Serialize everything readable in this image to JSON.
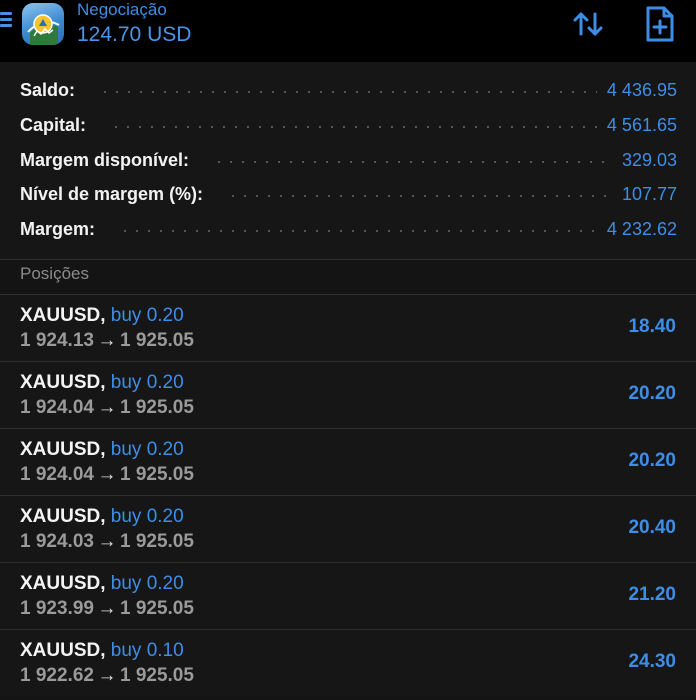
{
  "header": {
    "title": "Negociação",
    "subtitle": "124.70 USD",
    "icons": {
      "menu": "hamburger-menu-icon",
      "logo": "metatrader-logo",
      "sort": "sort-arrows-icon",
      "new_order": "new-order-document-plus-icon"
    }
  },
  "account": {
    "rows": [
      {
        "label": "Saldo:",
        "value": "4 436.95"
      },
      {
        "label": "Capital:",
        "value": "4 561.65"
      },
      {
        "label": "Margem disponível:",
        "value": "329.03"
      },
      {
        "label": "Nível de margem (%):",
        "value": "107.77"
      },
      {
        "label": "Margem:",
        "value": "4 232.62"
      }
    ]
  },
  "positions": {
    "header": "Posições",
    "items": [
      {
        "symbol": "XAUUSD",
        "comma": ",",
        "type": "buy 0.20",
        "open_price": "1 924.13",
        "arrow": "→",
        "current_price": "1 925.05",
        "profit": "18.40"
      },
      {
        "symbol": "XAUUSD",
        "comma": ",",
        "type": "buy 0.20",
        "open_price": "1 924.04",
        "arrow": "→",
        "current_price": "1 925.05",
        "profit": "20.20"
      },
      {
        "symbol": "XAUUSD",
        "comma": ",",
        "type": "buy 0.20",
        "open_price": "1 924.04",
        "arrow": "→",
        "current_price": "1 925.05",
        "profit": "20.20"
      },
      {
        "symbol": "XAUUSD",
        "comma": ",",
        "type": "buy 0.20",
        "open_price": "1 924.03",
        "arrow": "→",
        "current_price": "1 925.05",
        "profit": "20.40"
      },
      {
        "symbol": "XAUUSD",
        "comma": ",",
        "type": "buy 0.20",
        "open_price": "1 923.99",
        "arrow": "→",
        "current_price": "1 925.05",
        "profit": "21.20"
      },
      {
        "symbol": "XAUUSD",
        "comma": ",",
        "type": "buy 0.10",
        "open_price": "1 922.62",
        "arrow": "→",
        "current_price": "1 925.05",
        "profit": "24.30"
      }
    ]
  },
  "colors": {
    "accent": "#3d8ee6",
    "background": "#141414",
    "topbar": "#000000",
    "muted_text": "#9a9a9a"
  }
}
